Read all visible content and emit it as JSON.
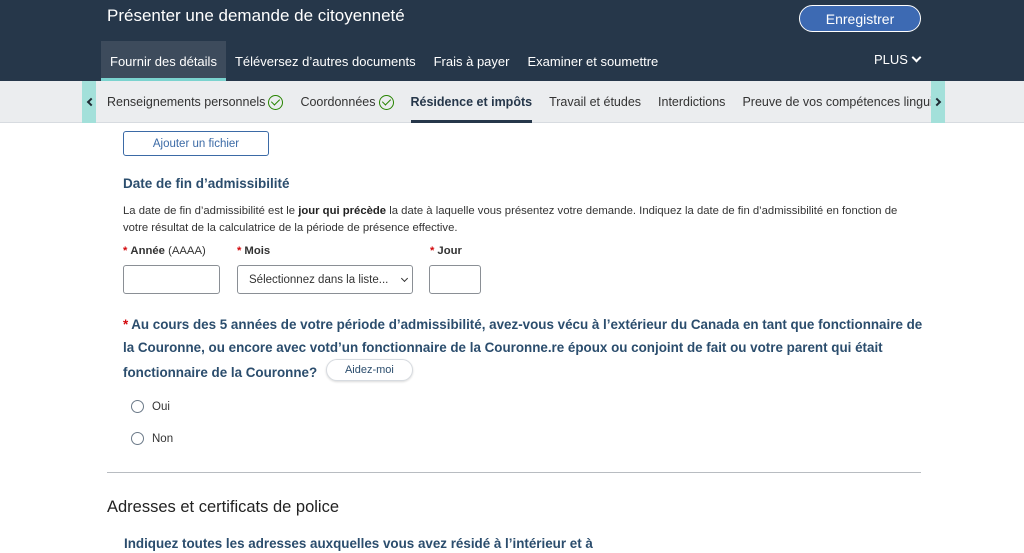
{
  "header": {
    "title": "Présenter une demande de citoyenneté",
    "save_label": "Enregistrer",
    "more_label": "PLUS"
  },
  "main_tabs": [
    {
      "label": "Fournir des détails",
      "active": true
    },
    {
      "label": "Téléversez d’autres documents",
      "active": false
    },
    {
      "label": "Frais à payer",
      "active": false
    },
    {
      "label": "Examiner et soumettre",
      "active": false
    }
  ],
  "sub_tabs": [
    {
      "label": "Renseignements personnels",
      "completed": true,
      "active": false
    },
    {
      "label": "Coordonnées",
      "completed": true,
      "active": false
    },
    {
      "label": "Résidence et impôts",
      "completed": false,
      "active": true
    },
    {
      "label": "Travail et études",
      "completed": false,
      "active": false
    },
    {
      "label": "Interdictions",
      "completed": false,
      "active": false
    },
    {
      "label": "Preuve de vos compétences linguistiques",
      "completed": false,
      "active": false
    }
  ],
  "form": {
    "add_file_label": "Ajouter un fichier",
    "eligibility_heading": "Date de fin d’admissibilité",
    "eligibility_text_before": "La date de fin d’admissibilité est le ",
    "eligibility_text_bold": "jour qui précède",
    "eligibility_text_after": " la date à laquelle vous présentez votre demande. Indiquez la date de fin d’admissibilité en fonction de votre résultat de la calculatrice de la période de présence effective.",
    "required_mark": "*",
    "year_label": "Année",
    "year_hint": "(AAAA)",
    "month_label": "Mois",
    "month_placeholder": "Sélectionnez dans la liste...",
    "day_label": "Jour",
    "question": "Au cours des 5 années de votre période d’admissibilité, avez-vous vécu à l’extérieur du Canada en tant que fonctionnaire de la Couronne, ou encore avec votd’un fonctionnaire de la Couronne.re époux ou conjoint de fait ou votre parent qui était fonctionnaire de la Couronne?",
    "help_label": "Aidez-moi",
    "option_yes": "Oui",
    "option_no": "Non"
  },
  "section2": {
    "title": "Adresses et certificats de police",
    "subtitle": "Indiquez toutes les adresses auxquelles vous avez résidé à l’intérieur et à"
  },
  "colors": {
    "header_bg": "#26374a",
    "accent_teal": "#7bd3cf",
    "heading_blue": "#2b4d6d",
    "required_red": "#d3080c",
    "check_green": "#278400"
  }
}
